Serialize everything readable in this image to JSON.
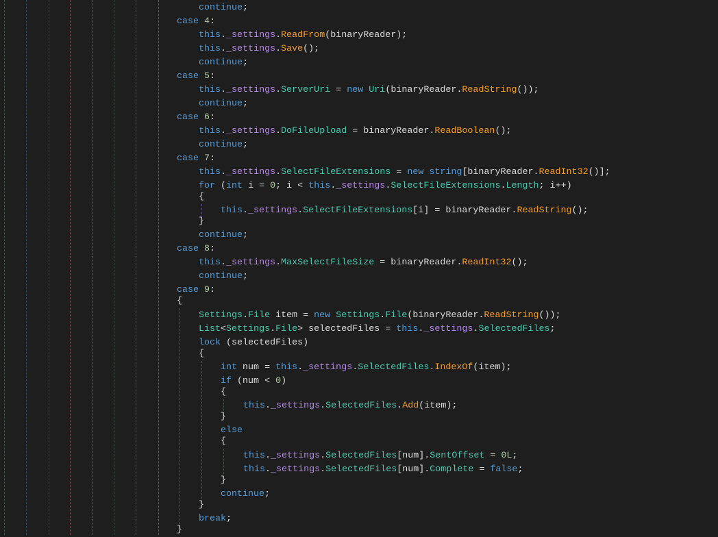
{
  "editor": {
    "theme_colors": {
      "background": "#1e1e1e",
      "keyword": "#569cd6",
      "field": "#b48ce0",
      "property": "#4ec9b0",
      "method": "#f0a030",
      "number": "#b5cea8",
      "text": "#dcdcdc"
    },
    "lines": [
      {
        "indent": 1,
        "tokens": [
          {
            "t": "continue",
            "k": "kw"
          },
          {
            "t": ";",
            "k": "pl"
          }
        ]
      },
      {
        "indent": 0,
        "tokens": [
          {
            "t": "case ",
            "k": "kw"
          },
          {
            "t": "4",
            "k": "num"
          },
          {
            "t": ":",
            "k": "pl"
          }
        ]
      },
      {
        "indent": 1,
        "tokens": [
          {
            "t": "this",
            "k": "kw"
          },
          {
            "t": ".",
            "k": "pl"
          },
          {
            "t": "_settings",
            "k": "fld"
          },
          {
            "t": ".",
            "k": "pl"
          },
          {
            "t": "ReadFrom",
            "k": "meth"
          },
          {
            "t": "(binaryReader);",
            "k": "pl"
          }
        ]
      },
      {
        "indent": 1,
        "tokens": [
          {
            "t": "this",
            "k": "kw"
          },
          {
            "t": ".",
            "k": "pl"
          },
          {
            "t": "_settings",
            "k": "fld"
          },
          {
            "t": ".",
            "k": "pl"
          },
          {
            "t": "Save",
            "k": "meth"
          },
          {
            "t": "();",
            "k": "pl"
          }
        ]
      },
      {
        "indent": 1,
        "tokens": [
          {
            "t": "continue",
            "k": "kw"
          },
          {
            "t": ";",
            "k": "pl"
          }
        ]
      },
      {
        "indent": 0,
        "tokens": [
          {
            "t": "case ",
            "k": "kw"
          },
          {
            "t": "5",
            "k": "num"
          },
          {
            "t": ":",
            "k": "pl"
          }
        ]
      },
      {
        "indent": 1,
        "tokens": [
          {
            "t": "this",
            "k": "kw"
          },
          {
            "t": ".",
            "k": "pl"
          },
          {
            "t": "_settings",
            "k": "fld"
          },
          {
            "t": ".",
            "k": "pl"
          },
          {
            "t": "ServerUri",
            "k": "prop"
          },
          {
            "t": " = ",
            "k": "pl"
          },
          {
            "t": "new ",
            "k": "kw"
          },
          {
            "t": "Uri",
            "k": "prop"
          },
          {
            "t": "(binaryReader.",
            "k": "pl"
          },
          {
            "t": "ReadString",
            "k": "meth"
          },
          {
            "t": "());",
            "k": "pl"
          }
        ]
      },
      {
        "indent": 1,
        "tokens": [
          {
            "t": "continue",
            "k": "kw"
          },
          {
            "t": ";",
            "k": "pl"
          }
        ]
      },
      {
        "indent": 0,
        "tokens": [
          {
            "t": "case ",
            "k": "kw"
          },
          {
            "t": "6",
            "k": "num"
          },
          {
            "t": ":",
            "k": "pl"
          }
        ]
      },
      {
        "indent": 1,
        "tokens": [
          {
            "t": "this",
            "k": "kw"
          },
          {
            "t": ".",
            "k": "pl"
          },
          {
            "t": "_settings",
            "k": "fld"
          },
          {
            "t": ".",
            "k": "pl"
          },
          {
            "t": "DoFileUpload",
            "k": "prop"
          },
          {
            "t": " = binaryReader.",
            "k": "pl"
          },
          {
            "t": "ReadBoolean",
            "k": "meth"
          },
          {
            "t": "();",
            "k": "pl"
          }
        ]
      },
      {
        "indent": 1,
        "tokens": [
          {
            "t": "continue",
            "k": "kw"
          },
          {
            "t": ";",
            "k": "pl"
          }
        ]
      },
      {
        "indent": 0,
        "tokens": [
          {
            "t": "case ",
            "k": "kw"
          },
          {
            "t": "7",
            "k": "num"
          },
          {
            "t": ":",
            "k": "pl"
          }
        ]
      },
      {
        "indent": 1,
        "tokens": [
          {
            "t": "this",
            "k": "kw"
          },
          {
            "t": ".",
            "k": "pl"
          },
          {
            "t": "_settings",
            "k": "fld"
          },
          {
            "t": ".",
            "k": "pl"
          },
          {
            "t": "SelectFileExtensions",
            "k": "prop"
          },
          {
            "t": " = ",
            "k": "pl"
          },
          {
            "t": "new string",
            "k": "kw"
          },
          {
            "t": "[binaryReader.",
            "k": "pl"
          },
          {
            "t": "ReadInt32",
            "k": "meth"
          },
          {
            "t": "()];",
            "k": "pl"
          }
        ]
      },
      {
        "indent": 1,
        "tokens": [
          {
            "t": "for ",
            "k": "kw"
          },
          {
            "t": "(",
            "k": "pl"
          },
          {
            "t": "int",
            "k": "kw"
          },
          {
            "t": " i = ",
            "k": "pl"
          },
          {
            "t": "0",
            "k": "num"
          },
          {
            "t": "; i < ",
            "k": "pl"
          },
          {
            "t": "this",
            "k": "kw"
          },
          {
            "t": ".",
            "k": "pl"
          },
          {
            "t": "_settings",
            "k": "fld"
          },
          {
            "t": ".",
            "k": "pl"
          },
          {
            "t": "SelectFileExtensions",
            "k": "prop"
          },
          {
            "t": ".",
            "k": "pl"
          },
          {
            "t": "Length",
            "k": "prop"
          },
          {
            "t": "; i++)",
            "k": "pl"
          }
        ]
      },
      {
        "indent": 1,
        "tokens": [
          {
            "t": "{",
            "k": "pl"
          }
        ]
      },
      {
        "indent": 2,
        "tokens": [
          {
            "t": "this",
            "k": "kw"
          },
          {
            "t": ".",
            "k": "pl"
          },
          {
            "t": "_settings",
            "k": "fld"
          },
          {
            "t": ".",
            "k": "pl"
          },
          {
            "t": "SelectFileExtensions",
            "k": "prop"
          },
          {
            "t": "[i] = binaryReader.",
            "k": "pl"
          },
          {
            "t": "ReadString",
            "k": "meth"
          },
          {
            "t": "();",
            "k": "pl"
          }
        ]
      },
      {
        "indent": 1,
        "tokens": [
          {
            "t": "}",
            "k": "pl"
          }
        ]
      },
      {
        "indent": 1,
        "tokens": [
          {
            "t": "continue",
            "k": "kw"
          },
          {
            "t": ";",
            "k": "pl"
          }
        ]
      },
      {
        "indent": 0,
        "tokens": [
          {
            "t": "case ",
            "k": "kw"
          },
          {
            "t": "8",
            "k": "num"
          },
          {
            "t": ":",
            "k": "pl"
          }
        ]
      },
      {
        "indent": 1,
        "tokens": [
          {
            "t": "this",
            "k": "kw"
          },
          {
            "t": ".",
            "k": "pl"
          },
          {
            "t": "_settings",
            "k": "fld"
          },
          {
            "t": ".",
            "k": "pl"
          },
          {
            "t": "MaxSelectFileSize",
            "k": "prop"
          },
          {
            "t": " = binaryReader.",
            "k": "pl"
          },
          {
            "t": "ReadInt32",
            "k": "meth"
          },
          {
            "t": "();",
            "k": "pl"
          }
        ]
      },
      {
        "indent": 1,
        "tokens": [
          {
            "t": "continue",
            "k": "kw"
          },
          {
            "t": ";",
            "k": "pl"
          }
        ]
      },
      {
        "indent": 0,
        "tokens": [
          {
            "t": "case ",
            "k": "kw"
          },
          {
            "t": "9",
            "k": "num"
          },
          {
            "t": ":",
            "k": "pl"
          }
        ]
      },
      {
        "indent": 0,
        "tokens": [
          {
            "t": "{",
            "k": "pl"
          }
        ]
      },
      {
        "indent": 1,
        "tokens": [
          {
            "t": "Settings",
            "k": "prop"
          },
          {
            "t": ".",
            "k": "pl"
          },
          {
            "t": "File",
            "k": "prop"
          },
          {
            "t": " item = ",
            "k": "pl"
          },
          {
            "t": "new ",
            "k": "kw"
          },
          {
            "t": "Settings",
            "k": "prop"
          },
          {
            "t": ".",
            "k": "pl"
          },
          {
            "t": "File",
            "k": "prop"
          },
          {
            "t": "(binaryReader.",
            "k": "pl"
          },
          {
            "t": "ReadString",
            "k": "meth"
          },
          {
            "t": "());",
            "k": "pl"
          }
        ]
      },
      {
        "indent": 1,
        "tokens": [
          {
            "t": "List",
            "k": "prop"
          },
          {
            "t": "<",
            "k": "pl"
          },
          {
            "t": "Settings",
            "k": "prop"
          },
          {
            "t": ".",
            "k": "pl"
          },
          {
            "t": "File",
            "k": "prop"
          },
          {
            "t": "> selectedFiles = ",
            "k": "pl"
          },
          {
            "t": "this",
            "k": "kw"
          },
          {
            "t": ".",
            "k": "pl"
          },
          {
            "t": "_settings",
            "k": "fld"
          },
          {
            "t": ".",
            "k": "pl"
          },
          {
            "t": "SelectedFiles",
            "k": "prop"
          },
          {
            "t": ";",
            "k": "pl"
          }
        ]
      },
      {
        "indent": 1,
        "tokens": [
          {
            "t": "lock ",
            "k": "kw"
          },
          {
            "t": "(selectedFiles)",
            "k": "pl"
          }
        ]
      },
      {
        "indent": 1,
        "tokens": [
          {
            "t": "{",
            "k": "pl"
          }
        ]
      },
      {
        "indent": 2,
        "tokens": [
          {
            "t": "int",
            "k": "kw"
          },
          {
            "t": " num = ",
            "k": "pl"
          },
          {
            "t": "this",
            "k": "kw"
          },
          {
            "t": ".",
            "k": "pl"
          },
          {
            "t": "_settings",
            "k": "fld"
          },
          {
            "t": ".",
            "k": "pl"
          },
          {
            "t": "SelectedFiles",
            "k": "prop"
          },
          {
            "t": ".",
            "k": "pl"
          },
          {
            "t": "IndexOf",
            "k": "meth"
          },
          {
            "t": "(item);",
            "k": "pl"
          }
        ]
      },
      {
        "indent": 2,
        "tokens": [
          {
            "t": "if ",
            "k": "kw"
          },
          {
            "t": "(num < ",
            "k": "pl"
          },
          {
            "t": "0",
            "k": "num"
          },
          {
            "t": ")",
            "k": "pl"
          }
        ]
      },
      {
        "indent": 2,
        "tokens": [
          {
            "t": "{",
            "k": "pl"
          }
        ]
      },
      {
        "indent": 3,
        "tokens": [
          {
            "t": "this",
            "k": "kw"
          },
          {
            "t": ".",
            "k": "pl"
          },
          {
            "t": "_settings",
            "k": "fld"
          },
          {
            "t": ".",
            "k": "pl"
          },
          {
            "t": "SelectedFiles",
            "k": "prop"
          },
          {
            "t": ".",
            "k": "pl"
          },
          {
            "t": "Add",
            "k": "meth"
          },
          {
            "t": "(item);",
            "k": "pl"
          }
        ]
      },
      {
        "indent": 2,
        "tokens": [
          {
            "t": "}",
            "k": "pl"
          }
        ]
      },
      {
        "indent": 2,
        "tokens": [
          {
            "t": "else",
            "k": "kw"
          }
        ]
      },
      {
        "indent": 2,
        "tokens": [
          {
            "t": "{",
            "k": "pl"
          }
        ]
      },
      {
        "indent": 3,
        "tokens": [
          {
            "t": "this",
            "k": "kw"
          },
          {
            "t": ".",
            "k": "pl"
          },
          {
            "t": "_settings",
            "k": "fld"
          },
          {
            "t": ".",
            "k": "pl"
          },
          {
            "t": "SelectedFiles",
            "k": "prop"
          },
          {
            "t": "[num].",
            "k": "pl"
          },
          {
            "t": "SentOffset",
            "k": "prop"
          },
          {
            "t": " = ",
            "k": "pl"
          },
          {
            "t": "0L",
            "k": "num"
          },
          {
            "t": ";",
            "k": "pl"
          }
        ]
      },
      {
        "indent": 3,
        "tokens": [
          {
            "t": "this",
            "k": "kw"
          },
          {
            "t": ".",
            "k": "pl"
          },
          {
            "t": "_settings",
            "k": "fld"
          },
          {
            "t": ".",
            "k": "pl"
          },
          {
            "t": "SelectedFiles",
            "k": "prop"
          },
          {
            "t": "[num].",
            "k": "pl"
          },
          {
            "t": "Complete",
            "k": "prop"
          },
          {
            "t": " = ",
            "k": "pl"
          },
          {
            "t": "false",
            "k": "kw"
          },
          {
            "t": ";",
            "k": "pl"
          }
        ]
      },
      {
        "indent": 2,
        "tokens": [
          {
            "t": "}",
            "k": "pl"
          }
        ]
      },
      {
        "indent": 2,
        "tokens": [
          {
            "t": "continue",
            "k": "kw"
          },
          {
            "t": ";",
            "k": "pl"
          }
        ]
      },
      {
        "indent": 1,
        "tokens": [
          {
            "t": "}",
            "k": "pl"
          }
        ]
      },
      {
        "indent": 1,
        "tokens": [
          {
            "t": "break",
            "k": "kw"
          },
          {
            "t": ";",
            "k": "pl"
          }
        ]
      },
      {
        "indent": 0,
        "tokens": [
          {
            "t": "}",
            "k": "pl"
          }
        ]
      }
    ]
  }
}
